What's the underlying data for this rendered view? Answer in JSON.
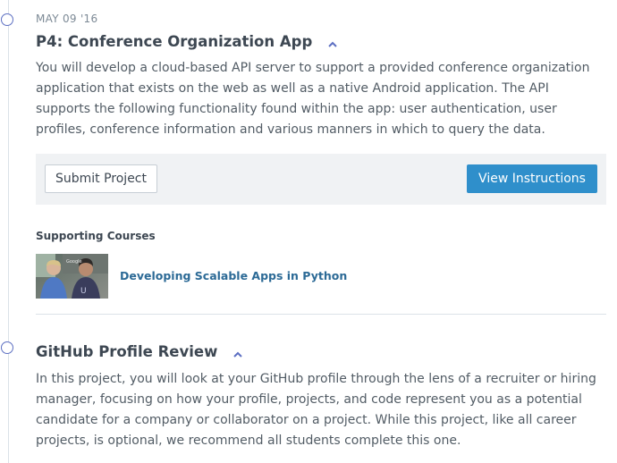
{
  "project1": {
    "date": "MAY 09 '16",
    "title": "P4: Conference Organization App",
    "description": "You will develop a cloud-based API server to support a provided conference organization application that exists on the web as well as a native Android application. The API supports the following functionality found within the app: user authentication, user profiles, conference information and various manners in which to query the data.",
    "submit_label": "Submit Project",
    "instructions_label": "View Instructions",
    "supporting_heading": "Supporting Courses",
    "courses": [
      {
        "title": "Developing Scalable Apps in Python",
        "thumbnail_text": "Google"
      }
    ]
  },
  "project2": {
    "title": "GitHub Profile Review",
    "description": "In this project, you will look at your GitHub profile through the lens of a recruiter or hiring manager, focusing on how your profile, projects, and code represent you as a potential candidate for a company or collaborator on a project. While this project, like all career projects, is optional, we recommend all students complete this one."
  },
  "colors": {
    "accent": "#2f8fcb",
    "timeline_dot": "#5c6fc2",
    "link": "#2c6a96",
    "heading": "#3d4752",
    "body_text": "#525c65"
  },
  "icons": {
    "collapse": "chevron-up-icon",
    "timeline_marker": "circle-outline-icon"
  }
}
